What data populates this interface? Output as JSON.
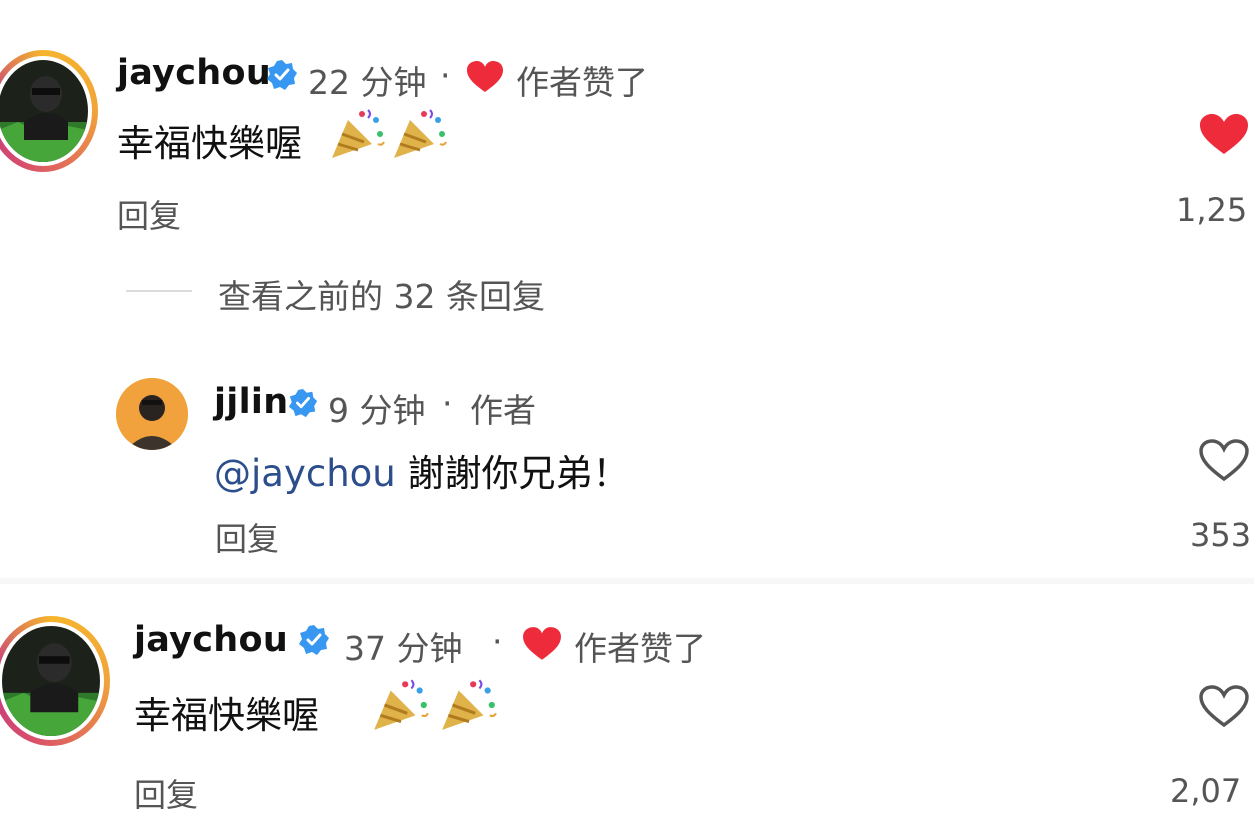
{
  "comments": [
    {
      "username": "jaychou",
      "time": "22 分钟",
      "separator": "·",
      "author_liked": "作者赞了",
      "text": "幸福快樂喔",
      "emoji": "🎉🎉",
      "reply_label": "回复",
      "like_count": "1,25",
      "liked": true
    },
    {
      "username": "jjlin",
      "time": "9 分钟",
      "separator": "·",
      "author_tag": "作者",
      "mention": "@jaychou",
      "text": "謝謝你兄弟！",
      "reply_label": "回复",
      "like_count": "353",
      "liked": false
    },
    {
      "username": "jaychou",
      "time": "37 分钟",
      "separator": "·",
      "author_liked": "作者赞了",
      "text": "幸福快樂喔",
      "emoji": "🎉🎉",
      "reply_label": "回复",
      "like_count": "2,07",
      "liked": false
    }
  ],
  "view_previous_replies": "查看之前的 32 条回复",
  "colors": {
    "heart_red": "#ed2b3a",
    "verified_blue": "#3897f0",
    "mention_blue": "#2d4e8c",
    "secondary_text": "#555555"
  },
  "icons": {
    "verified": "verified-badge-icon",
    "heart_filled": "heart-filled-icon",
    "heart_outline": "heart-outline-icon",
    "party_popper": "party-popper-icon"
  }
}
